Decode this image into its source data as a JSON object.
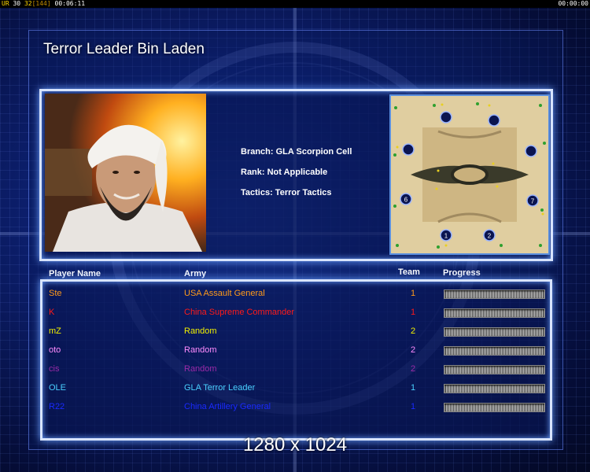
{
  "topbar": {
    "left_a": "UR",
    "left_b": "30",
    "left_c": "32",
    "left_d": "[144]",
    "left_e": "00:06:11",
    "right": "00:00:00"
  },
  "title": "Terror Leader Bin Laden",
  "general_info": {
    "branch": "Branch: GLA Scorpion Cell",
    "rank": "Rank: Not Applicable",
    "tactics": "Tactics: Terror Tactics"
  },
  "minimap": {
    "start_positions": [
      "1",
      "2",
      "3",
      "4",
      "5",
      "6",
      "7",
      "8"
    ]
  },
  "columns": {
    "player": "Player Name",
    "army": "Army",
    "team": "Team",
    "progress": "Progress"
  },
  "players": [
    {
      "name": "Ste",
      "army": "USA Assault General",
      "team": "1",
      "color": "#ff9a1a",
      "progress": 1.0
    },
    {
      "name": "K",
      "army": "China Supreme Commander",
      "team": "1",
      "color": "#ff1a1a",
      "progress": 1.0
    },
    {
      "name": "mZ",
      "army": "Random",
      "team": "2",
      "color": "#f2f000",
      "progress": 1.0
    },
    {
      "name": "oto",
      "army": "Random",
      "team": "2",
      "color": "#ff8cff",
      "progress": 1.0
    },
    {
      "name": "cis",
      "army": "Random",
      "team": "2",
      "color": "#9b2aa8",
      "progress": 1.0
    },
    {
      "name": "OLE",
      "army": "GLA Terror Leader",
      "team": "1",
      "color": "#4ad0ff",
      "progress": 1.0
    },
    {
      "name": "R22",
      "army": "China Artillery General",
      "team": "1",
      "color": "#1a2aff",
      "progress": 1.0
    }
  ],
  "resolution_caption": "1280 x 1024"
}
